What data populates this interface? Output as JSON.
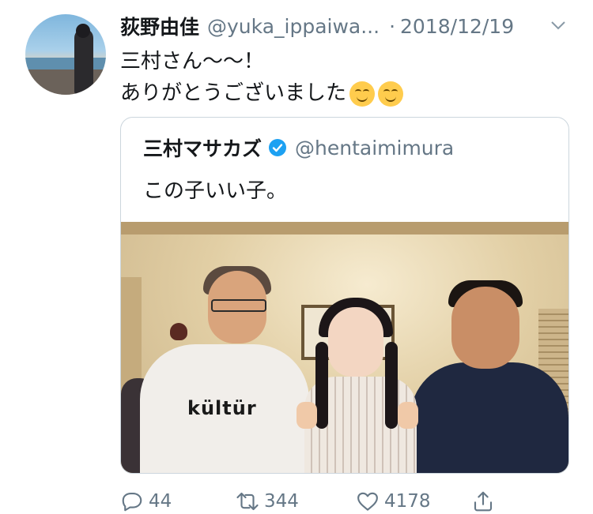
{
  "tweet": {
    "author_name": "荻野由佳",
    "author_handle": "@yuka_ippaiwa...",
    "separator": "·",
    "date": "2018/12/19",
    "text_line1": "三村さん〜〜！",
    "text_line2": "ありがとうございました",
    "emojis": [
      "smiling-face-icon",
      "smiling-face-icon"
    ]
  },
  "quoted_tweet": {
    "author_name": "三村マサカズ",
    "verified": true,
    "author_handle": "@hentaimimura",
    "text": "この子いい子。",
    "photo": {
      "shirt_text": "kültür"
    }
  },
  "actions": {
    "reply_count": "44",
    "retweet_count": "344",
    "like_count": "4178"
  },
  "colors": {
    "text": "#14171a",
    "secondary": "#657786",
    "verified_blue": "#1da1f2",
    "border": "#ccd6dd"
  }
}
